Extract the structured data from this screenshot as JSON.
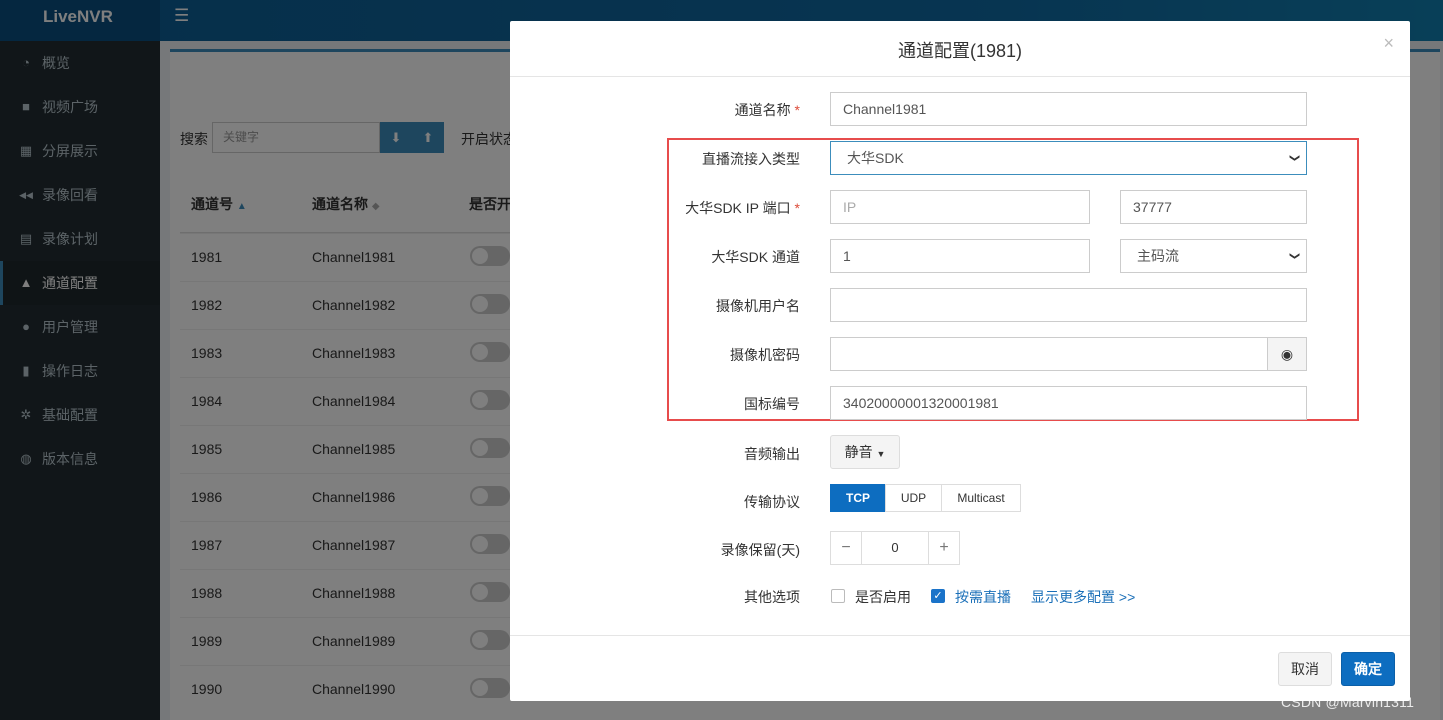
{
  "app": {
    "title": "LiveNVR"
  },
  "sidebar": {
    "items": [
      {
        "label": "概览",
        "icon": "dashboard-icon",
        "glyph": "◔",
        "active": false
      },
      {
        "label": "视频广场",
        "icon": "video-camera-icon",
        "glyph": "■",
        "active": false
      },
      {
        "label": "分屏展示",
        "icon": "grid-icon",
        "glyph": "▦",
        "active": false
      },
      {
        "label": "录像回看",
        "icon": "rewind-icon",
        "glyph": "◀◀",
        "active": false
      },
      {
        "label": "录像计划",
        "icon": "calendar-icon",
        "glyph": "▤",
        "active": false
      },
      {
        "label": "通道配置",
        "icon": "road-icon",
        "glyph": "▲",
        "active": true
      },
      {
        "label": "用户管理",
        "icon": "users-icon",
        "glyph": "●",
        "active": false
      },
      {
        "label": "操作日志",
        "icon": "file-icon",
        "glyph": "▮",
        "active": false
      },
      {
        "label": "基础配置",
        "icon": "gears-icon",
        "glyph": "✲",
        "active": false
      },
      {
        "label": "版本信息",
        "icon": "globe-icon",
        "glyph": "◍",
        "active": false
      }
    ]
  },
  "toolbar": {
    "search_label": "搜索",
    "search_placeholder": "关键字",
    "filter_label": "开启状态"
  },
  "table": {
    "headers": {
      "id": "通道号",
      "name": "通道名称",
      "enabled": "是否开"
    },
    "rows": [
      {
        "id": "1981",
        "name": "Channel1981"
      },
      {
        "id": "1982",
        "name": "Channel1982"
      },
      {
        "id": "1983",
        "name": "Channel1983"
      },
      {
        "id": "1984",
        "name": "Channel1984"
      },
      {
        "id": "1985",
        "name": "Channel1985"
      },
      {
        "id": "1986",
        "name": "Channel1986"
      },
      {
        "id": "1987",
        "name": "Channel1987"
      },
      {
        "id": "1988",
        "name": "Channel1988"
      },
      {
        "id": "1989",
        "name": "Channel1989"
      },
      {
        "id": "1990",
        "name": "Channel1990"
      }
    ]
  },
  "modal": {
    "title": "通道配置(1981)",
    "close": "×",
    "fields": {
      "channel_name_label": "通道名称",
      "channel_name_value": "Channel1981",
      "stream_type_label": "直播流接入类型",
      "stream_type_value": "大华SDK",
      "sdk_ip_label": "大华SDK IP 端口",
      "sdk_ip_placeholder": "IP",
      "sdk_port_value": "37777",
      "sdk_channel_label": "大华SDK 通道",
      "sdk_channel_value": "1",
      "stream_select_value": "主码流",
      "cam_user_label": "摄像机用户名",
      "cam_user_value": "",
      "cam_pass_label": "摄像机密码",
      "cam_pass_value": "",
      "gb_code_label": "国标编号",
      "gb_code_value": "34020000001320001981",
      "audio_label": "音频输出",
      "audio_value": "静音",
      "protocol_label": "传输协议",
      "protocol_options": [
        "TCP",
        "UDP",
        "Multicast"
      ],
      "protocol_selected": "TCP",
      "retention_label": "录像保留(天)",
      "retention_value": "0",
      "other_label": "其他选项",
      "opt_enabled": "是否启用",
      "opt_enabled_checked": false,
      "opt_ondemand": "按需直播",
      "opt_ondemand_checked": true,
      "more_link": "显示更多配置 >>"
    },
    "required_mark": "*",
    "cancel_label": "取消",
    "ok_label": "确定"
  },
  "watermark": "CSDN @Marvin1311",
  "colors": {
    "primary": "#0d6dc0",
    "sidebar_bg": "#222d32",
    "highlight": "#e74c4c",
    "topbar": "#0d5d93"
  }
}
